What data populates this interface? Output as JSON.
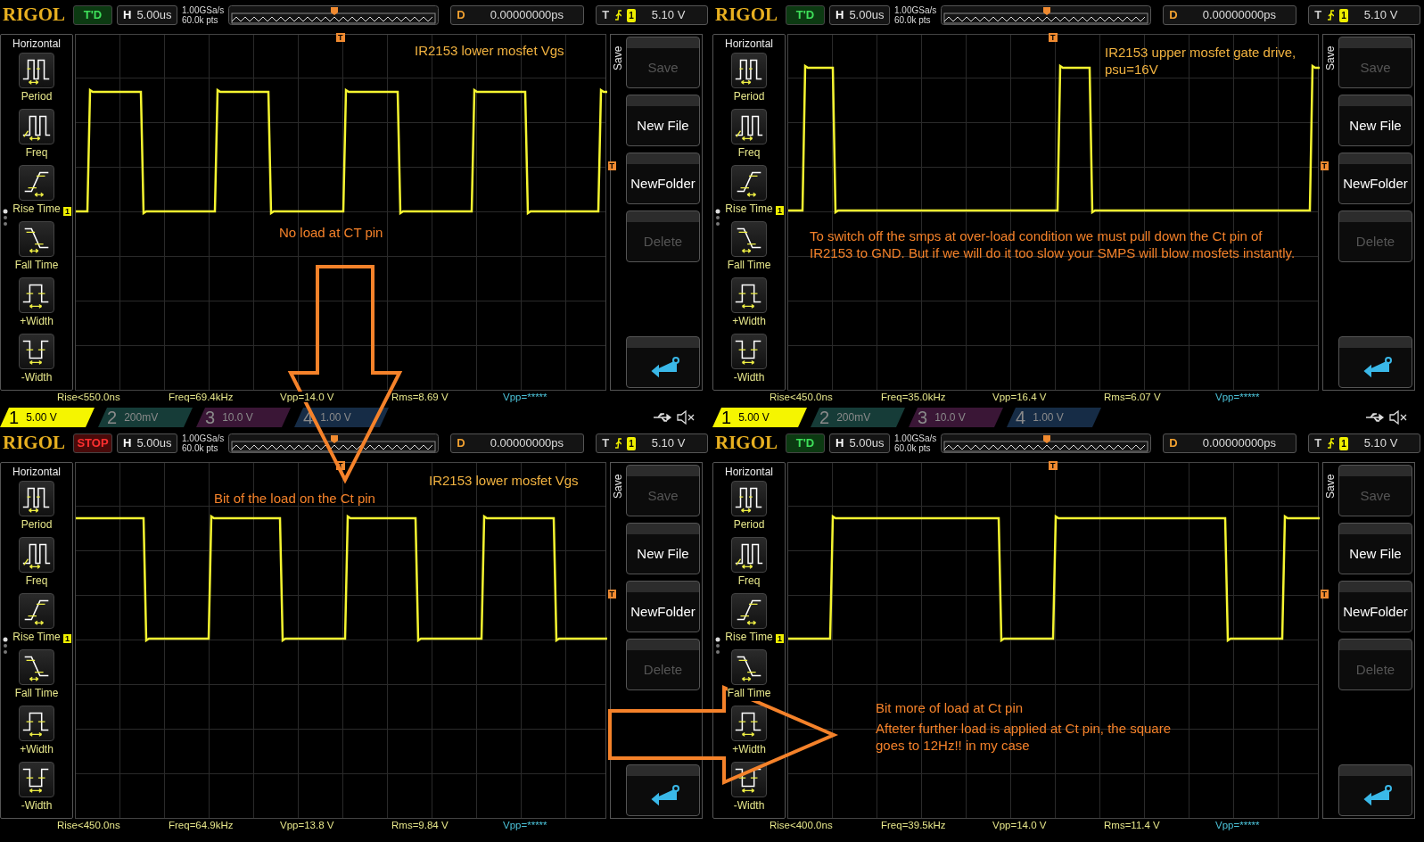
{
  "panels": [
    {
      "header": {
        "logo": "RIGOL",
        "stopped": false,
        "status": "T'D",
        "h_label": "H",
        "timebase": "5.00us",
        "sample_rate": "1.00GSa/s",
        "memory_depth": "60.0k pts",
        "delay_label": "D",
        "delay": "0.00000000ps",
        "trigger_label": "T",
        "trigger_source": "1",
        "trigger_level": "5.10 V"
      },
      "sidebar": {
        "title": "Horizontal",
        "items": [
          {
            "kind": "period",
            "label": "Period"
          },
          {
            "kind": "freq",
            "label": "Freq"
          },
          {
            "kind": "rise",
            "label": "Rise Time"
          },
          {
            "kind": "fall",
            "label": "Fall Time"
          },
          {
            "kind": "pwidth",
            "label": "+Width"
          },
          {
            "kind": "nwidth",
            "label": "-Width"
          }
        ]
      },
      "markers": {
        "channel": "1",
        "trigger_top": "T",
        "trigger_right": "T"
      },
      "menu": {
        "tab": "Save",
        "buttons": [
          {
            "kind": "text",
            "label": "Save",
            "disabled": true
          },
          {
            "kind": "text",
            "label": "New File",
            "disabled": false
          },
          {
            "kind": "text",
            "label": "NewFolder",
            "disabled": false
          },
          {
            "kind": "text",
            "label": "Delete",
            "disabled": true
          },
          {
            "kind": "back"
          }
        ]
      },
      "measurements": [
        {
          "text": "Rise<550.0ns",
          "color": "#e6e68a"
        },
        {
          "text": "Freq=69.4kHz",
          "color": "#e6e68a"
        },
        {
          "text": "Vpp=14.0 V",
          "color": "#e6e68a"
        },
        {
          "text": "Rms=8.69 V",
          "color": "#e6e68a"
        },
        {
          "text": "Vpp=*****",
          "color": "#4cc3d9"
        }
      ],
      "channels": [
        {
          "number": "1",
          "scale": "5.00 V",
          "active": true,
          "color": "#f5f500"
        },
        {
          "number": "2",
          "scale": "200mV",
          "active": false,
          "color": "#163c38"
        },
        {
          "number": "3",
          "scale": "10.0 V",
          "active": false,
          "color": "#3a1636"
        },
        {
          "number": "4",
          "scale": "1.00 V",
          "active": false,
          "color": "#162c46"
        }
      ],
      "annotations": [
        {
          "text": "IR2153 lower mosfet Vgs",
          "color": "#f2b340"
        },
        {
          "text": "No load at CT pin",
          "color": "#f5822a"
        }
      ]
    },
    {
      "header": {
        "logo": "RIGOL",
        "stopped": false,
        "status": "T'D",
        "h_label": "H",
        "timebase": "5.00us",
        "sample_rate": "1.00GSa/s",
        "memory_depth": "60.0k pts",
        "delay_label": "D",
        "delay": "0.00000000ps",
        "trigger_label": "T",
        "trigger_source": "1",
        "trigger_level": "5.10 V"
      },
      "sidebar": {
        "title": "Horizontal",
        "items": [
          {
            "kind": "period",
            "label": "Period"
          },
          {
            "kind": "freq",
            "label": "Freq"
          },
          {
            "kind": "rise",
            "label": "Rise Time"
          },
          {
            "kind": "fall",
            "label": "Fall Time"
          },
          {
            "kind": "pwidth",
            "label": "+Width"
          },
          {
            "kind": "nwidth",
            "label": "-Width"
          }
        ]
      },
      "markers": {
        "channel": "1",
        "trigger_top": "T",
        "trigger_right": "T"
      },
      "menu": {
        "tab": "Save",
        "buttons": [
          {
            "kind": "text",
            "label": "Save",
            "disabled": true
          },
          {
            "kind": "text",
            "label": "New File",
            "disabled": false
          },
          {
            "kind": "text",
            "label": "NewFolder",
            "disabled": false
          },
          {
            "kind": "text",
            "label": "Delete",
            "disabled": true
          },
          {
            "kind": "back"
          }
        ]
      },
      "measurements": [
        {
          "text": "Rise<450.0ns",
          "color": "#e6e68a"
        },
        {
          "text": "Freq=35.0kHz",
          "color": "#e6e68a"
        },
        {
          "text": "Vpp=16.4 V",
          "color": "#e6e68a"
        },
        {
          "text": "Rms=6.07 V",
          "color": "#e6e68a"
        },
        {
          "text": "Vpp=*****",
          "color": "#4cc3d9"
        }
      ],
      "channels": [
        {
          "number": "1",
          "scale": "5.00 V",
          "active": true,
          "color": "#f5f500"
        },
        {
          "number": "2",
          "scale": "200mV",
          "active": false,
          "color": "#163c38"
        },
        {
          "number": "3",
          "scale": "10.0 V",
          "active": false,
          "color": "#3a1636"
        },
        {
          "number": "4",
          "scale": "1.00 V",
          "active": false,
          "color": "#162c46"
        }
      ],
      "annotations": [
        {
          "text": "IR2153 upper mosfet gate drive, psu=16V",
          "color": "#f2b340"
        },
        {
          "text": "To switch off the smps at over-load condition we must pull down the Ct pin of IR2153 to GND. But if we will do it too slow your SMPS will blow mosfets instantly.",
          "color": "#f5822a"
        }
      ]
    },
    {
      "header": {
        "logo": "RIGOL",
        "stopped": true,
        "status": "STOP",
        "h_label": "H",
        "timebase": "5.00us",
        "sample_rate": "1.00GSa/s",
        "memory_depth": "60.0k pts",
        "delay_label": "D",
        "delay": "0.00000000ps",
        "trigger_label": "T",
        "trigger_source": "1",
        "trigger_level": "5.10 V"
      },
      "sidebar": {
        "title": "Horizontal",
        "items": [
          {
            "kind": "period",
            "label": "Period"
          },
          {
            "kind": "freq",
            "label": "Freq"
          },
          {
            "kind": "rise",
            "label": "Rise Time"
          },
          {
            "kind": "fall",
            "label": "Fall Time"
          },
          {
            "kind": "pwidth",
            "label": "+Width"
          },
          {
            "kind": "nwidth",
            "label": "-Width"
          }
        ]
      },
      "markers": {
        "channel": "1",
        "trigger_top": "T",
        "trigger_right": "T"
      },
      "menu": {
        "tab": "Save",
        "buttons": [
          {
            "kind": "text",
            "label": "Save",
            "disabled": true
          },
          {
            "kind": "text",
            "label": "New File",
            "disabled": false
          },
          {
            "kind": "text",
            "label": "NewFolder",
            "disabled": false
          },
          {
            "kind": "text",
            "label": "Delete",
            "disabled": true
          },
          {
            "kind": "back"
          }
        ]
      },
      "measurements": [
        {
          "text": "Rise<450.0ns",
          "color": "#e6e68a"
        },
        {
          "text": "Freq=64.9kHz",
          "color": "#e6e68a"
        },
        {
          "text": "Vpp=13.8 V",
          "color": "#e6e68a"
        },
        {
          "text": "Rms=9.84 V",
          "color": "#e6e68a"
        },
        {
          "text": "Vpp=*****",
          "color": "#4cc3d9"
        }
      ],
      "annotations": [
        {
          "text": "IR2153 lower mosfet Vgs",
          "color": "#f2b340"
        },
        {
          "text": "Bit of the load on the Ct pin",
          "color": "#f5822a"
        }
      ]
    },
    {
      "header": {
        "logo": "RIGOL",
        "stopped": false,
        "status": "T'D",
        "h_label": "H",
        "timebase": "5.00us",
        "sample_rate": "1.00GSa/s",
        "memory_depth": "60.0k pts",
        "delay_label": "D",
        "delay": "0.00000000ps",
        "trigger_label": "T",
        "trigger_source": "1",
        "trigger_level": "5.10 V"
      },
      "sidebar": {
        "title": "Horizontal",
        "items": [
          {
            "kind": "period",
            "label": "Period"
          },
          {
            "kind": "freq",
            "label": "Freq"
          },
          {
            "kind": "rise",
            "label": "Rise Time"
          },
          {
            "kind": "fall",
            "label": "Fall Time"
          },
          {
            "kind": "pwidth",
            "label": "+Width"
          },
          {
            "kind": "nwidth",
            "label": "-Width"
          }
        ]
      },
      "markers": {
        "channel": "1",
        "trigger_top": "T",
        "trigger_right": "T"
      },
      "menu": {
        "tab": "Save",
        "buttons": [
          {
            "kind": "text",
            "label": "Save",
            "disabled": true
          },
          {
            "kind": "text",
            "label": "New File",
            "disabled": false
          },
          {
            "kind": "text",
            "label": "NewFolder",
            "disabled": false
          },
          {
            "kind": "text",
            "label": "Delete",
            "disabled": true
          },
          {
            "kind": "back"
          }
        ]
      },
      "measurements": [
        {
          "text": "Rise<400.0ns",
          "color": "#e6e68a"
        },
        {
          "text": "Freq=39.5kHz",
          "color": "#e6e68a"
        },
        {
          "text": "Vpp=14.0 V",
          "color": "#e6e68a"
        },
        {
          "text": "Rms=11.4 V",
          "color": "#e6e68a"
        },
        {
          "text": "Vpp=*****",
          "color": "#4cc3d9"
        }
      ],
      "annotations": [
        {
          "text": "Bit more of load at Ct pin",
          "color": "#f5822a"
        },
        {
          "text": "Afteter further load is applied at Ct pin, the square goes to 12Hz!! in my case",
          "color": "#f5822a"
        }
      ]
    }
  ]
}
